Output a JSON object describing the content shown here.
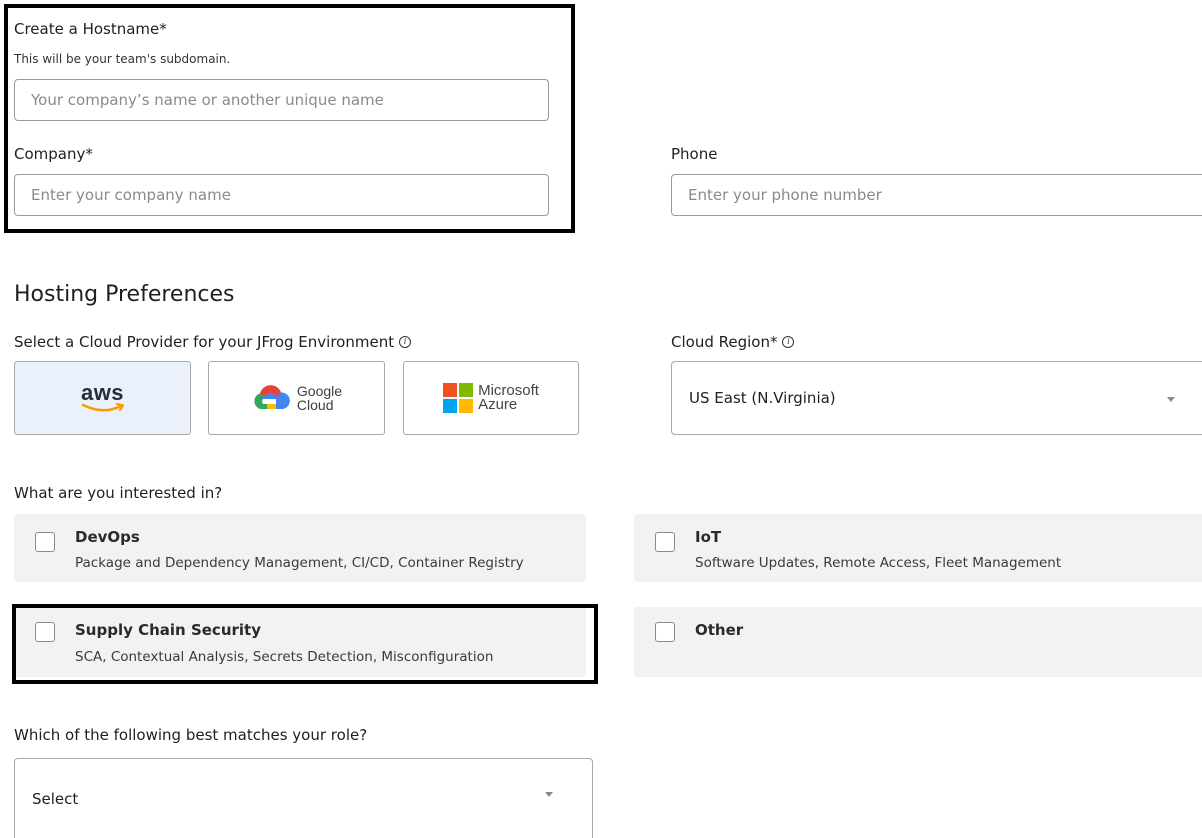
{
  "hostname": {
    "label": "Create a Hostname*",
    "helper": "This will be your team's subdomain.",
    "placeholder": "Your company’s name or another unique name"
  },
  "company": {
    "label": "Company*",
    "placeholder": "Enter your company name"
  },
  "phone": {
    "label": "Phone",
    "placeholder": "Enter your phone number"
  },
  "hosting": {
    "title": "Hosting Preferences",
    "provider_label": "Select a Cloud Provider for your JFrog Environment",
    "providers": [
      {
        "name": "aws",
        "selected": true
      },
      {
        "name_line1": "Google",
        "name_line2": "Cloud",
        "selected": false
      },
      {
        "name_line1": "Microsoft",
        "name_line2": "Azure",
        "selected": false
      }
    ],
    "region_label": "Cloud Region*",
    "region_value": "US East (N.Virginia)"
  },
  "interests": {
    "label": "What are you interested in?",
    "items": [
      {
        "title": "DevOps",
        "desc": "Package and Dependency Management, CI/CD, Container Registry",
        "checked": false
      },
      {
        "title": "IoT",
        "desc": "Software Updates, Remote Access, Fleet Management",
        "checked": false
      },
      {
        "title": "Supply Chain Security",
        "desc": "SCA, Contextual Analysis, Secrets Detection, Misconfiguration",
        "checked": false
      },
      {
        "title": "Other",
        "desc": "",
        "checked": false
      }
    ]
  },
  "role": {
    "label": "Which of the following best matches your role?",
    "value": "Select"
  },
  "colors": {
    "selected_provider_bg": "#eaf1fb",
    "card_bg": "#f2f2f2",
    "highlight_border": "#000000"
  }
}
